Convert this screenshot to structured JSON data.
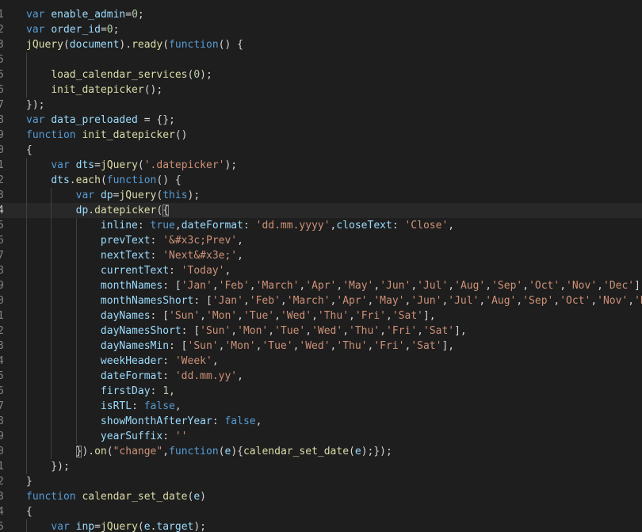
{
  "theme": {
    "background": "#1e1e1e",
    "current_line": "#282828",
    "colors": {
      "k": "#569cd6",
      "v": "#9cdcfe",
      "f": "#dcdcaa",
      "s": "#ce9178",
      "n": "#b5cea8",
      "p": "#d4d4d4"
    }
  },
  "editor": {
    "current_line_index": 13,
    "lines": [
      {
        "num": "1",
        "tokens": [
          [
            "k",
            "var"
          ],
          [
            "p",
            " "
          ],
          [
            "v",
            "enable_admin"
          ],
          [
            "p",
            "="
          ],
          [
            "n",
            "0"
          ],
          [
            "p",
            ";"
          ]
        ]
      },
      {
        "num": "2",
        "tokens": [
          [
            "k",
            "var"
          ],
          [
            "p",
            " "
          ],
          [
            "v",
            "order_id"
          ],
          [
            "p",
            "="
          ],
          [
            "n",
            "0"
          ],
          [
            "p",
            ";"
          ]
        ]
      },
      {
        "num": "3",
        "tokens": [
          [
            "f",
            "jQuery"
          ],
          [
            "p",
            "("
          ],
          [
            "v",
            "document"
          ],
          [
            "p",
            ")."
          ],
          [
            "f",
            "ready"
          ],
          [
            "p",
            "("
          ],
          [
            "k",
            "function"
          ],
          [
            "p",
            "() {"
          ]
        ]
      },
      {
        "num": "5",
        "tokens": []
      },
      {
        "num": "5",
        "tokens": [
          [
            "p",
            "    "
          ],
          [
            "f",
            "load_calendar_services"
          ],
          [
            "p",
            "("
          ],
          [
            "n",
            "0"
          ],
          [
            "p",
            ");"
          ]
        ]
      },
      {
        "num": "6",
        "tokens": [
          [
            "p",
            "    "
          ],
          [
            "f",
            "init_datepicker"
          ],
          [
            "p",
            "();"
          ]
        ]
      },
      {
        "num": "7",
        "tokens": [
          [
            "p",
            "});"
          ]
        ]
      },
      {
        "num": "8",
        "tokens": [
          [
            "k",
            "var"
          ],
          [
            "p",
            " "
          ],
          [
            "v",
            "data_preloaded"
          ],
          [
            "p",
            " = {};"
          ]
        ]
      },
      {
        "num": "9",
        "tokens": [
          [
            "k",
            "function"
          ],
          [
            "p",
            " "
          ],
          [
            "f",
            "init_datepicker"
          ],
          [
            "p",
            "()"
          ]
        ]
      },
      {
        "num": "0",
        "tokens": [
          [
            "p",
            "{"
          ]
        ]
      },
      {
        "num": "1",
        "tokens": [
          [
            "p",
            "    "
          ],
          [
            "k",
            "var"
          ],
          [
            "p",
            " "
          ],
          [
            "v",
            "dts"
          ],
          [
            "p",
            "="
          ],
          [
            "f",
            "jQuery"
          ],
          [
            "p",
            "("
          ],
          [
            "s",
            "'.datepicker'"
          ],
          [
            "p",
            ");"
          ]
        ]
      },
      {
        "num": "2",
        "tokens": [
          [
            "p",
            "    "
          ],
          [
            "v",
            "dts"
          ],
          [
            "p",
            "."
          ],
          [
            "f",
            "each"
          ],
          [
            "p",
            "("
          ],
          [
            "k",
            "function"
          ],
          [
            "p",
            "() {"
          ]
        ]
      },
      {
        "num": "3",
        "tokens": [
          [
            "p",
            "        "
          ],
          [
            "k",
            "var"
          ],
          [
            "p",
            " "
          ],
          [
            "v",
            "dp"
          ],
          [
            "p",
            "="
          ],
          [
            "f",
            "jQuery"
          ],
          [
            "p",
            "("
          ],
          [
            "k",
            "this"
          ],
          [
            "p",
            ");"
          ]
        ]
      },
      {
        "num": "4",
        "tokens": [
          [
            "p",
            "        "
          ],
          [
            "v",
            "dp"
          ],
          [
            "p",
            "."
          ],
          [
            "f",
            "datepicker"
          ],
          [
            "p",
            "("
          ],
          [
            "b",
            "{"
          ]
        ]
      },
      {
        "num": "5",
        "tokens": [
          [
            "p",
            "            "
          ],
          [
            "v",
            "inline"
          ],
          [
            "p",
            ": "
          ],
          [
            "k",
            "true"
          ],
          [
            "p",
            ","
          ],
          [
            "v",
            "dateFormat"
          ],
          [
            "p",
            ": "
          ],
          [
            "s",
            "'dd.mm.yyyy'"
          ],
          [
            "p",
            ","
          ],
          [
            "v",
            "closeText"
          ],
          [
            "p",
            ": "
          ],
          [
            "s",
            "'Close'"
          ],
          [
            "p",
            ","
          ]
        ]
      },
      {
        "num": "6",
        "tokens": [
          [
            "p",
            "            "
          ],
          [
            "v",
            "prevText"
          ],
          [
            "p",
            ": "
          ],
          [
            "s",
            "'&#x3c;Prev'"
          ],
          [
            "p",
            ","
          ]
        ]
      },
      {
        "num": "7",
        "tokens": [
          [
            "p",
            "            "
          ],
          [
            "v",
            "nextText"
          ],
          [
            "p",
            ": "
          ],
          [
            "s",
            "'Next&#x3e;'"
          ],
          [
            "p",
            ","
          ]
        ]
      },
      {
        "num": "8",
        "tokens": [
          [
            "p",
            "            "
          ],
          [
            "v",
            "currentText"
          ],
          [
            "p",
            ": "
          ],
          [
            "s",
            "'Today'"
          ],
          [
            "p",
            ","
          ]
        ]
      },
      {
        "num": "9",
        "tokens": [
          [
            "p",
            "            "
          ],
          [
            "v",
            "monthNames"
          ],
          [
            "p",
            ": ["
          ],
          [
            "s",
            "'Jan'"
          ],
          [
            "p",
            ","
          ],
          [
            "s",
            "'Feb'"
          ],
          [
            "p",
            ","
          ],
          [
            "s",
            "'March'"
          ],
          [
            "p",
            ","
          ],
          [
            "s",
            "'Apr'"
          ],
          [
            "p",
            ","
          ],
          [
            "s",
            "'May'"
          ],
          [
            "p",
            ","
          ],
          [
            "s",
            "'Jun'"
          ],
          [
            "p",
            ","
          ],
          [
            "s",
            "'Jul'"
          ],
          [
            "p",
            ","
          ],
          [
            "s",
            "'Aug'"
          ],
          [
            "p",
            ","
          ],
          [
            "s",
            "'Sep'"
          ],
          [
            "p",
            ","
          ],
          [
            "s",
            "'Oct'"
          ],
          [
            "p",
            ","
          ],
          [
            "s",
            "'Nov'"
          ],
          [
            "p",
            ","
          ],
          [
            "s",
            "'Dec'"
          ],
          [
            "p",
            "],"
          ]
        ]
      },
      {
        "num": "0",
        "tokens": [
          [
            "p",
            "            "
          ],
          [
            "v",
            "monthNamesShort"
          ],
          [
            "p",
            ": ["
          ],
          [
            "s",
            "'Jan'"
          ],
          [
            "p",
            ","
          ],
          [
            "s",
            "'Feb'"
          ],
          [
            "p",
            ","
          ],
          [
            "s",
            "'March'"
          ],
          [
            "p",
            ","
          ],
          [
            "s",
            "'Apr'"
          ],
          [
            "p",
            ","
          ],
          [
            "s",
            "'May'"
          ],
          [
            "p",
            ","
          ],
          [
            "s",
            "'Jun'"
          ],
          [
            "p",
            ","
          ],
          [
            "s",
            "'Jul'"
          ],
          [
            "p",
            ","
          ],
          [
            "s",
            "'Aug'"
          ],
          [
            "p",
            ","
          ],
          [
            "s",
            "'Sep'"
          ],
          [
            "p",
            ","
          ],
          [
            "s",
            "'Oct'"
          ],
          [
            "p",
            ","
          ],
          [
            "s",
            "'Nov'"
          ],
          [
            "p",
            ","
          ],
          [
            "s",
            "'De"
          ]
        ]
      },
      {
        "num": "1",
        "tokens": [
          [
            "p",
            "            "
          ],
          [
            "v",
            "dayNames"
          ],
          [
            "p",
            ": ["
          ],
          [
            "s",
            "'Sun'"
          ],
          [
            "p",
            ","
          ],
          [
            "s",
            "'Mon'"
          ],
          [
            "p",
            ","
          ],
          [
            "s",
            "'Tue'"
          ],
          [
            "p",
            ","
          ],
          [
            "s",
            "'Wed'"
          ],
          [
            "p",
            ","
          ],
          [
            "s",
            "'Thu'"
          ],
          [
            "p",
            ","
          ],
          [
            "s",
            "'Fri'"
          ],
          [
            "p",
            ","
          ],
          [
            "s",
            "'Sat'"
          ],
          [
            "p",
            "],"
          ]
        ]
      },
      {
        "num": "2",
        "tokens": [
          [
            "p",
            "            "
          ],
          [
            "v",
            "dayNamesShort"
          ],
          [
            "p",
            ": ["
          ],
          [
            "s",
            "'Sun'"
          ],
          [
            "p",
            ","
          ],
          [
            "s",
            "'Mon'"
          ],
          [
            "p",
            ","
          ],
          [
            "s",
            "'Tue'"
          ],
          [
            "p",
            ","
          ],
          [
            "s",
            "'Wed'"
          ],
          [
            "p",
            ","
          ],
          [
            "s",
            "'Thu'"
          ],
          [
            "p",
            ","
          ],
          [
            "s",
            "'Fri'"
          ],
          [
            "p",
            ","
          ],
          [
            "s",
            "'Sat'"
          ],
          [
            "p",
            "],"
          ]
        ]
      },
      {
        "num": "3",
        "tokens": [
          [
            "p",
            "            "
          ],
          [
            "v",
            "dayNamesMin"
          ],
          [
            "p",
            ": ["
          ],
          [
            "s",
            "'Sun'"
          ],
          [
            "p",
            ","
          ],
          [
            "s",
            "'Mon'"
          ],
          [
            "p",
            ","
          ],
          [
            "s",
            "'Tue'"
          ],
          [
            "p",
            ","
          ],
          [
            "s",
            "'Wed'"
          ],
          [
            "p",
            ","
          ],
          [
            "s",
            "'Thu'"
          ],
          [
            "p",
            ","
          ],
          [
            "s",
            "'Fri'"
          ],
          [
            "p",
            ","
          ],
          [
            "s",
            "'Sat'"
          ],
          [
            "p",
            "],"
          ]
        ]
      },
      {
        "num": "4",
        "tokens": [
          [
            "p",
            "            "
          ],
          [
            "v",
            "weekHeader"
          ],
          [
            "p",
            ": "
          ],
          [
            "s",
            "'Week'"
          ],
          [
            "p",
            ","
          ]
        ]
      },
      {
        "num": "5",
        "tokens": [
          [
            "p",
            "            "
          ],
          [
            "v",
            "dateFormat"
          ],
          [
            "p",
            ": "
          ],
          [
            "s",
            "'dd.mm.yy'"
          ],
          [
            "p",
            ","
          ]
        ]
      },
      {
        "num": "6",
        "tokens": [
          [
            "p",
            "            "
          ],
          [
            "v",
            "firstDay"
          ],
          [
            "p",
            ": "
          ],
          [
            "n",
            "1"
          ],
          [
            "p",
            ","
          ]
        ]
      },
      {
        "num": "7",
        "tokens": [
          [
            "p",
            "            "
          ],
          [
            "v",
            "isRTL"
          ],
          [
            "p",
            ": "
          ],
          [
            "k",
            "false"
          ],
          [
            "p",
            ","
          ]
        ]
      },
      {
        "num": "8",
        "tokens": [
          [
            "p",
            "            "
          ],
          [
            "v",
            "showMonthAfterYear"
          ],
          [
            "p",
            ": "
          ],
          [
            "k",
            "false"
          ],
          [
            "p",
            ","
          ]
        ]
      },
      {
        "num": "9",
        "tokens": [
          [
            "p",
            "            "
          ],
          [
            "v",
            "yearSuffix"
          ],
          [
            "p",
            ": "
          ],
          [
            "s",
            "''"
          ]
        ]
      },
      {
        "num": "0",
        "tokens": [
          [
            "p",
            "        "
          ],
          [
            "b",
            "}"
          ],
          [
            "p",
            ")."
          ],
          [
            "f",
            "on"
          ],
          [
            "p",
            "("
          ],
          [
            "s",
            "\"change\""
          ],
          [
            "p",
            ","
          ],
          [
            "k",
            "function"
          ],
          [
            "p",
            "("
          ],
          [
            "v",
            "e"
          ],
          [
            "p",
            "){"
          ],
          [
            "f",
            "calendar_set_date"
          ],
          [
            "p",
            "("
          ],
          [
            "v",
            "e"
          ],
          [
            "p",
            ");});"
          ]
        ]
      },
      {
        "num": "1",
        "tokens": [
          [
            "p",
            "    });"
          ]
        ]
      },
      {
        "num": "2",
        "tokens": [
          [
            "p",
            "}"
          ]
        ]
      },
      {
        "num": "3",
        "tokens": [
          [
            "k",
            "function"
          ],
          [
            "p",
            " "
          ],
          [
            "f",
            "calendar_set_date"
          ],
          [
            "p",
            "("
          ],
          [
            "v",
            "e"
          ],
          [
            "p",
            ")"
          ]
        ]
      },
      {
        "num": "4",
        "tokens": [
          [
            "p",
            "{"
          ]
        ]
      },
      {
        "num": "5",
        "tokens": [
          [
            "p",
            "    "
          ],
          [
            "k",
            "var"
          ],
          [
            "p",
            " "
          ],
          [
            "v",
            "inp"
          ],
          [
            "p",
            "="
          ],
          [
            "f",
            "jQuery"
          ],
          [
            "p",
            "("
          ],
          [
            "v",
            "e"
          ],
          [
            "p",
            "."
          ],
          [
            "v",
            "target"
          ],
          [
            "p",
            ");"
          ]
        ]
      }
    ]
  }
}
